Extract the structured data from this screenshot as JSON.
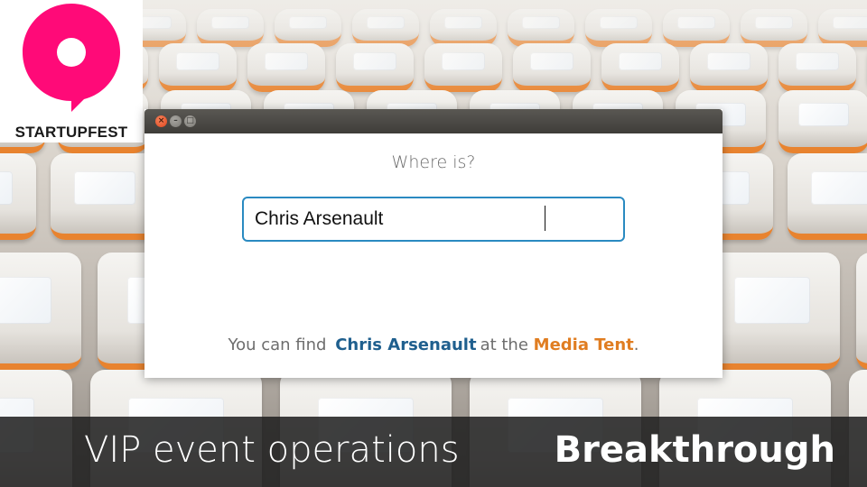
{
  "logo": {
    "text": "STARTUPFEST",
    "color": "#ff0a78"
  },
  "window": {
    "controls": [
      "close-icon",
      "minimize-icon",
      "maximize-icon"
    ],
    "question": "Where is?",
    "search": {
      "value": "Chris Arsenault",
      "border_color": "#2a8ac1"
    },
    "result": {
      "prefix": "You can find",
      "name": "Chris Arsenault",
      "middle": "at the",
      "place": "Media Tent",
      "suffix": ".",
      "name_color": "#1f5f8e",
      "place_color": "#e07d21"
    }
  },
  "caption": {
    "left": "VIP event operations",
    "right": "Breakthrough"
  }
}
